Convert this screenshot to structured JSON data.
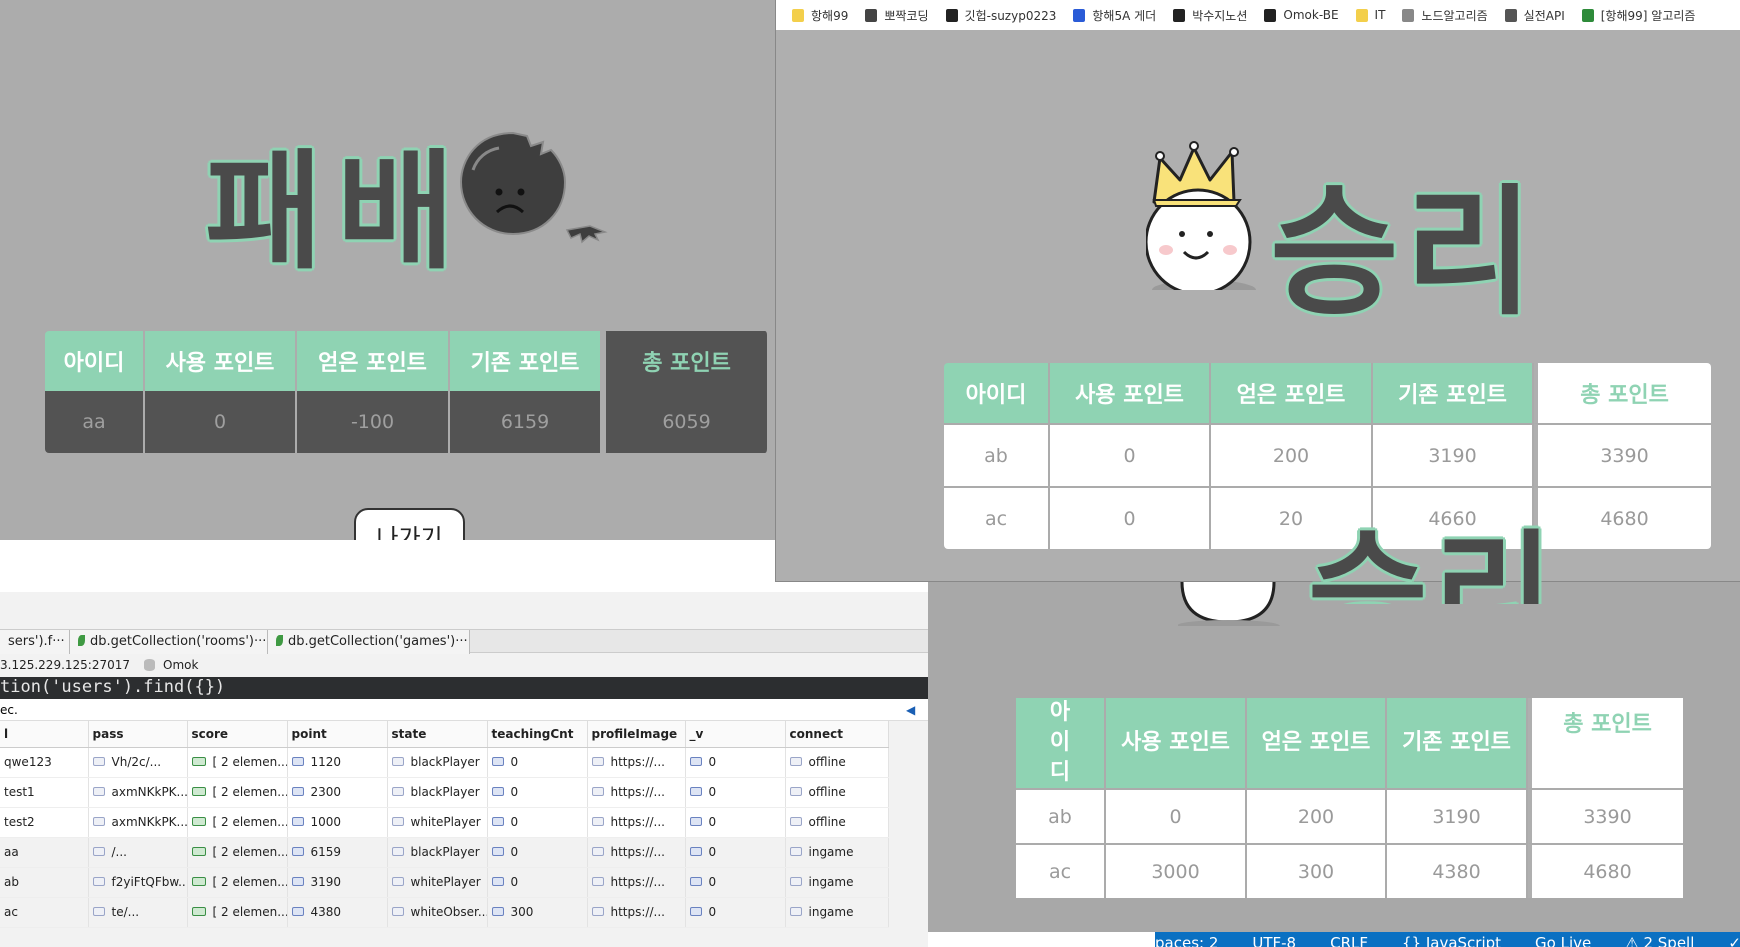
{
  "loss": {
    "title": "패배",
    "headers": [
      "아이디",
      "사용 포인트",
      "얻은 포인트",
      "기존 포인트",
      "총 포인트"
    ],
    "row": [
      "aa",
      "0",
      "-100",
      "6159",
      "6059"
    ],
    "exit_label": "나가기"
  },
  "win": {
    "bookmarks": [
      "항해99",
      "뽀짝코딩",
      "깃헙-suzyp0223",
      "항해5A 게더",
      "박수지노션",
      "Omok-BE",
      "IT",
      "노드알고리즘",
      "실전API",
      "[항해99] 알고리즘"
    ],
    "title": "승리",
    "headers": [
      "아이디",
      "사용 포인트",
      "얻은 포인트",
      "기존 포인트",
      "총 포인트"
    ],
    "rows": [
      [
        "ab",
        "0",
        "200",
        "3190",
        "3390"
      ],
      [
        "ac",
        "0",
        "20",
        "4660",
        "4680"
      ]
    ]
  },
  "win2": {
    "title": "승리",
    "headers": [
      "아이디",
      "사용 포인트",
      "얻은 포인트",
      "기존 포인트",
      "총 포인트"
    ],
    "rows": [
      [
        "ab",
        "0",
        "200",
        "3190",
        "3390"
      ],
      [
        "ac",
        "3000",
        "300",
        "4380",
        "4680"
      ]
    ]
  },
  "statusbar": [
    "paces: 2",
    "UTF-8",
    "CRLF",
    "{} JavaScript",
    "Go Live",
    "⚠ 2 Spell",
    "✓ Pr"
  ],
  "mongo": {
    "tabs": [
      "sers').f···",
      "db.getCollection('rooms')···",
      "db.getCollection('games')···"
    ],
    "connection": "3.125.229.125:27017",
    "database": "Omok",
    "query": "tion('users').find({})",
    "exec_text": "ec.",
    "columns": [
      "l",
      "pass",
      "score",
      "point",
      "state",
      "teachingCnt",
      "profileImage",
      "_v",
      "connect"
    ],
    "rows": [
      [
        "qwe123",
        "Vh/2c/...",
        "[ 2 elemen...",
        "1120",
        "blackPlayer",
        "0",
        "https://...",
        "0",
        "offline"
      ],
      [
        "test1",
        "axmNKkPK...",
        "[ 2 elemen...",
        "2300",
        "blackPlayer",
        "0",
        "https://...",
        "0",
        "offline"
      ],
      [
        "test2",
        "axmNKkPK...",
        "[ 2 elemen...",
        "1000",
        "whitePlayer",
        "0",
        "https://...",
        "0",
        "offline"
      ],
      [
        "aa",
        "/...",
        "[ 2 elemen...",
        "6159",
        "blackPlayer",
        "0",
        "https://...",
        "0",
        "ingame"
      ],
      [
        "ab",
        "f2yiFtQFbw...",
        "[ 2 elemen...",
        "3190",
        "whitePlayer",
        "0",
        "https://...",
        "0",
        "ingame"
      ],
      [
        "ac",
        "te/...",
        "[ 2 elemen...",
        "4380",
        "whiteObser...",
        "300",
        "https://...",
        "0",
        "ingame"
      ]
    ]
  }
}
